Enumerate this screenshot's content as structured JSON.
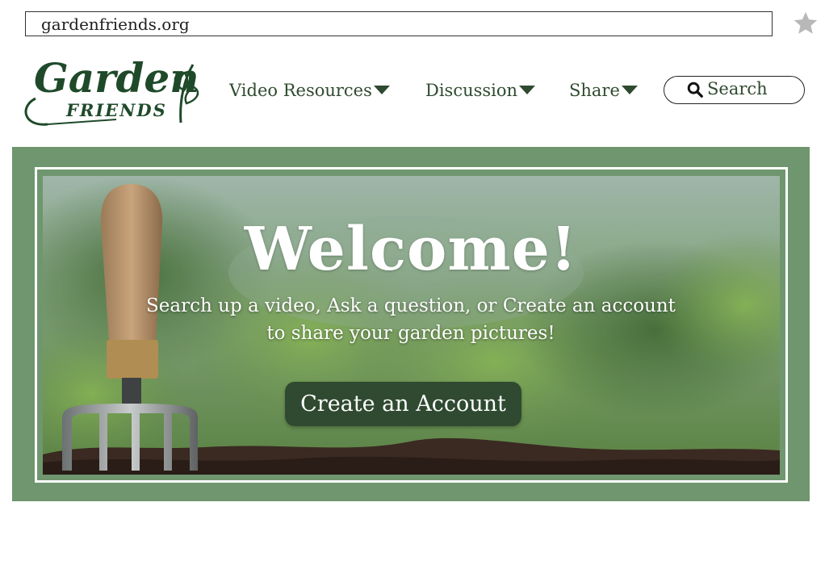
{
  "browser": {
    "url": "gardenfriends.org",
    "bookmark_icon": "star-icon"
  },
  "logo": {
    "line1": "Garden",
    "line2": "FRIENDS",
    "icon": "leaf-sprout-icon",
    "color": "#1f4a2a"
  },
  "nav": {
    "items": [
      {
        "label": "Video Resources",
        "icon": "caret-down-icon"
      },
      {
        "label": "Discussion",
        "icon": "caret-down-icon"
      },
      {
        "label": "Share",
        "icon": "caret-down-icon"
      }
    ]
  },
  "search": {
    "label": "Search",
    "icon": "search-icon"
  },
  "hero": {
    "title": "Welcome!",
    "subtitle": "Search up a video, Ask a question, or Create an account to share your garden pictures!",
    "cta_label": "Create an Account",
    "image_icon": "garden-fork-in-soil-photo"
  },
  "colors": {
    "brand_green": "#2f4a2f",
    "frame_green": "#6f966e",
    "button_green": "#2f4a30",
    "star_gray": "#b8b8b8"
  }
}
